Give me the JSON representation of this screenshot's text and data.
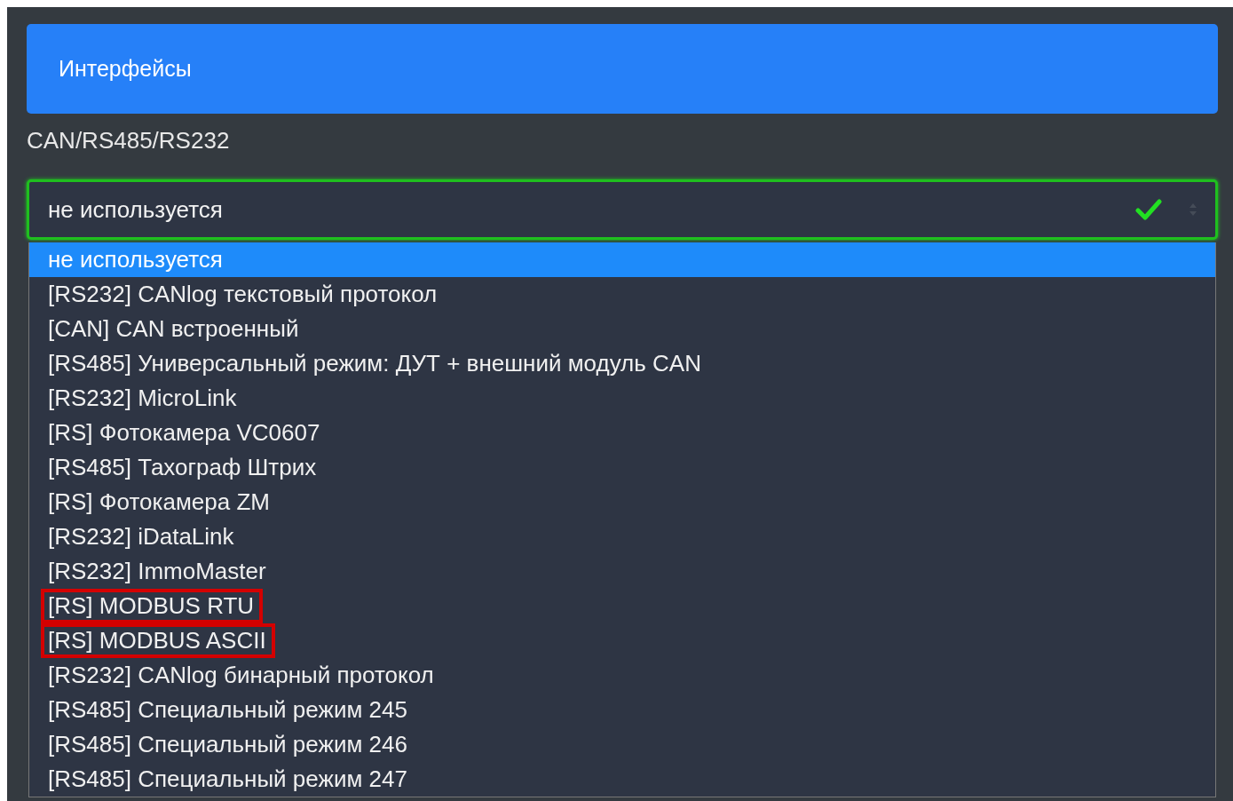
{
  "header": {
    "title": "Интерфейсы"
  },
  "field_label": "CAN/RS485/RS232",
  "select": {
    "value": "не используется",
    "valid": true
  },
  "options": [
    {
      "label": "не используется",
      "selected": true,
      "highlighted": false
    },
    {
      "label": "[RS232] CANlog текстовый протокол",
      "selected": false,
      "highlighted": false
    },
    {
      "label": "[CAN] CAN встроенный",
      "selected": false,
      "highlighted": false
    },
    {
      "label": "[RS485] Универсальный режим: ДУТ + внешний модуль CAN",
      "selected": false,
      "highlighted": false
    },
    {
      "label": "[RS232] MicroLink",
      "selected": false,
      "highlighted": false
    },
    {
      "label": "[RS] Фотокамера VC0607",
      "selected": false,
      "highlighted": false
    },
    {
      "label": "[RS485] Тахограф Штрих",
      "selected": false,
      "highlighted": false
    },
    {
      "label": "[RS] Фотокамера ZM",
      "selected": false,
      "highlighted": false
    },
    {
      "label": "[RS232] iDataLink",
      "selected": false,
      "highlighted": false
    },
    {
      "label": "[RS232] ImmoMaster",
      "selected": false,
      "highlighted": false
    },
    {
      "label": "[RS] MODBUS RTU",
      "selected": false,
      "highlighted": true
    },
    {
      "label": "[RS] MODBUS ASCII",
      "selected": false,
      "highlighted": true
    },
    {
      "label": "[RS232] CANlog бинарный протокол",
      "selected": false,
      "highlighted": false
    },
    {
      "label": "[RS485] Специальный режим 245",
      "selected": false,
      "highlighted": false
    },
    {
      "label": "[RS485] Специальный режим 246",
      "selected": false,
      "highlighted": false
    },
    {
      "label": "[RS485] Специальный режим 247",
      "selected": false,
      "highlighted": false
    }
  ]
}
